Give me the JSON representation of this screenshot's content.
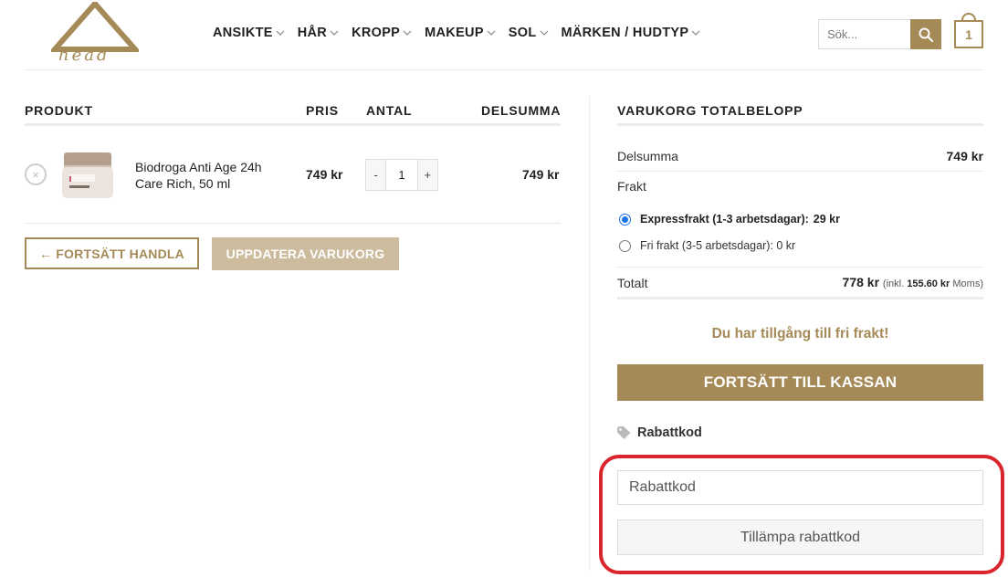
{
  "header": {
    "logo_text": "head",
    "nav": [
      {
        "label": "ANSIKTE"
      },
      {
        "label": "HÅR"
      },
      {
        "label": "KROPP"
      },
      {
        "label": "MAKEUP"
      },
      {
        "label": "SOL"
      },
      {
        "label": "MÄRKEN / HUDTYP"
      }
    ],
    "search_placeholder": "Sök...",
    "cart_count": "1"
  },
  "cart": {
    "columns": {
      "product": "PRODUKT",
      "price": "PRIS",
      "quantity": "ANTAL",
      "subtotal": "DELSUMMA"
    },
    "items": [
      {
        "remove_symbol": "×",
        "name": "Biodroga Anti Age 24h Care Rich, 50 ml",
        "price": "749 kr",
        "quantity": "1",
        "minus": "-",
        "plus": "+",
        "subtotal": "749 kr"
      }
    ],
    "continue_label": "← FORTSÄTT HANDLA",
    "update_label": "UPPDATERA VARUKORG"
  },
  "totals": {
    "title": "VARUKORG TOTALBELOPP",
    "subtotal_label": "Delsumma",
    "subtotal_value": "749 kr",
    "shipping_label": "Frakt",
    "shipping_options": [
      {
        "label": "Expressfrakt (1-3 arbetsdagar):",
        "price": "29 kr",
        "selected": true
      },
      {
        "label": "Fri frakt (3-5 arbetsdagar): 0 kr",
        "selected": false
      }
    ],
    "total_label": "Totalt",
    "total_value": "778 kr",
    "tax_prefix": "(inkl.",
    "tax_value": "155.60 kr",
    "tax_suffix": "Moms)",
    "free_shipping_notice": "Du har tillgång till fri frakt!",
    "checkout_label": "FORTSÄTT TILL KASSAN"
  },
  "coupon": {
    "heading": "Rabattkod",
    "placeholder": "Rabattkod",
    "apply_label": "Tillämpa rabattkod"
  },
  "colors": {
    "brand": "#a58a57",
    "brand_light": "#ccbb9c",
    "highlight": "#d9252b"
  }
}
